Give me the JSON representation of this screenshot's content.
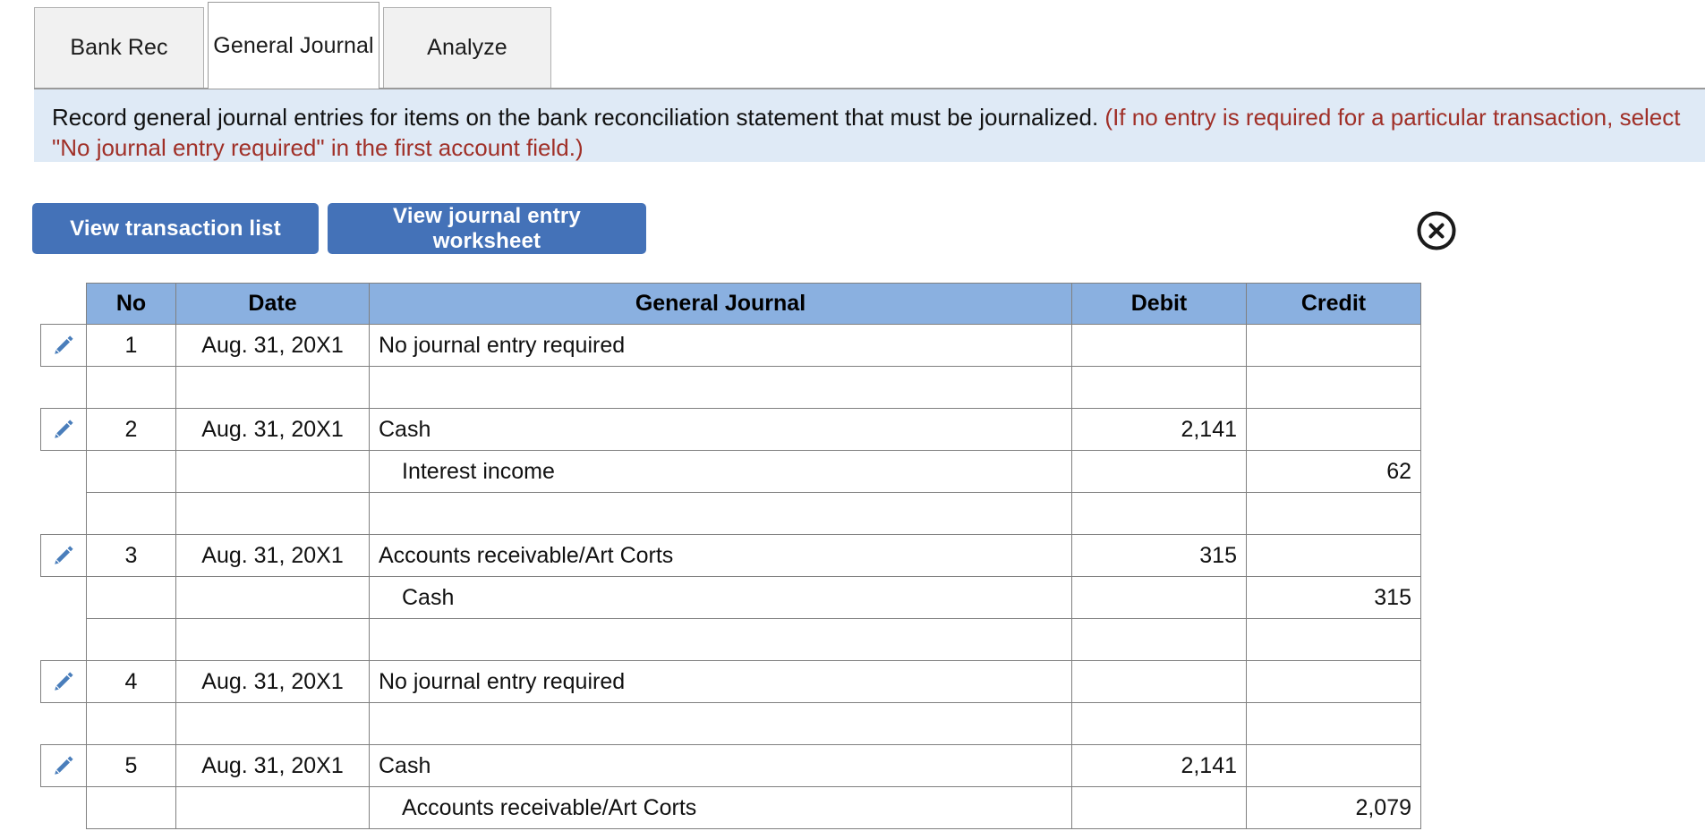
{
  "tabs": [
    {
      "id": "bank-rec",
      "label": "Bank Rec",
      "active": false
    },
    {
      "id": "general-journal",
      "label": "General Journal",
      "active": true
    },
    {
      "id": "analyze",
      "label": "Analyze",
      "active": false
    }
  ],
  "banner": {
    "main_text": "Record general journal entries for items on the bank reconciliation statement that must be journalized.",
    "hint_text": "(If no entry is required for a particular transaction, select \"No journal entry required\" in the first account field.)",
    "background_color": "#dfeaf6",
    "hint_color": "#a03028"
  },
  "toolbar": {
    "view_transaction_list_label": "View transaction list",
    "view_journal_worksheet_label": "View journal entry worksheet",
    "button_color": "#4472b8",
    "close_icon": "close-circle-icon"
  },
  "table": {
    "header_color": "#8ab0e0",
    "edit_icon": "pencil-icon",
    "columns": [
      "No",
      "Date",
      "General Journal",
      "Debit",
      "Credit"
    ],
    "rows": [
      {
        "edit": true,
        "no": "1",
        "date": "Aug. 31, 20X1",
        "account": "No journal entry required",
        "indent": false,
        "debit": "",
        "credit": ""
      },
      {
        "edit": false,
        "no": "",
        "date": "",
        "account": "",
        "indent": false,
        "debit": "",
        "credit": ""
      },
      {
        "edit": true,
        "no": "2",
        "date": "Aug. 31, 20X1",
        "account": "Cash",
        "indent": false,
        "debit": "2,141",
        "credit": ""
      },
      {
        "edit": false,
        "no": "",
        "date": "",
        "account": "Interest income",
        "indent": true,
        "debit": "",
        "credit": "62"
      },
      {
        "edit": false,
        "no": "",
        "date": "",
        "account": "",
        "indent": false,
        "debit": "",
        "credit": ""
      },
      {
        "edit": true,
        "no": "3",
        "date": "Aug. 31, 20X1",
        "account": "Accounts receivable/Art Corts",
        "indent": false,
        "debit": "315",
        "credit": ""
      },
      {
        "edit": false,
        "no": "",
        "date": "",
        "account": "Cash",
        "indent": true,
        "debit": "",
        "credit": "315"
      },
      {
        "edit": false,
        "no": "",
        "date": "",
        "account": "",
        "indent": false,
        "debit": "",
        "credit": ""
      },
      {
        "edit": true,
        "no": "4",
        "date": "Aug. 31, 20X1",
        "account": "No journal entry required",
        "indent": false,
        "debit": "",
        "credit": ""
      },
      {
        "edit": false,
        "no": "",
        "date": "",
        "account": "",
        "indent": false,
        "debit": "",
        "credit": ""
      },
      {
        "edit": true,
        "no": "5",
        "date": "Aug. 31, 20X1",
        "account": "Cash",
        "indent": false,
        "debit": "2,141",
        "credit": ""
      },
      {
        "edit": false,
        "no": "",
        "date": "",
        "account": "Accounts receivable/Art Corts",
        "indent": true,
        "debit": "",
        "credit": "2,079"
      }
    ]
  }
}
